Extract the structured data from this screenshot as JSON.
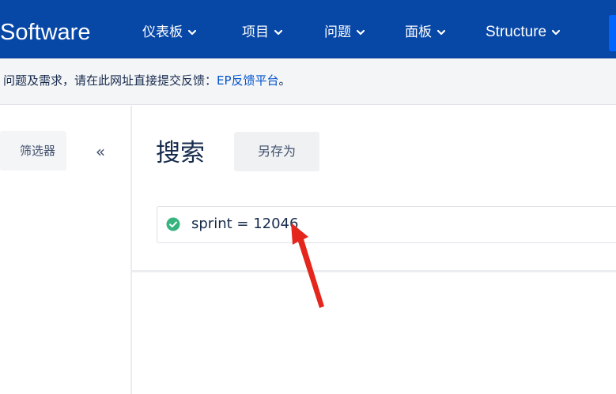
{
  "header": {
    "logo_text": "Software",
    "nav": [
      {
        "label": "仪表板"
      },
      {
        "label": "项目"
      },
      {
        "label": "问题"
      },
      {
        "label": "面板"
      },
      {
        "label": "Structure"
      }
    ]
  },
  "banner": {
    "text": "问题及需求，请在此网址直接提交反馈：",
    "link_text": "EP反馈平台",
    "suffix": "。"
  },
  "sidebar": {
    "filter_button_label": "筛选器",
    "collapse_glyph": "«"
  },
  "search": {
    "title": "搜索",
    "save_as_label": "另存为",
    "jql_query": "sprint = 12046",
    "status_icon": "check-circle-icon",
    "status_color": "#36b37e"
  },
  "colors": {
    "nav_background": "#0747a6",
    "link": "#0052cc",
    "annotation": "#e5261c"
  }
}
